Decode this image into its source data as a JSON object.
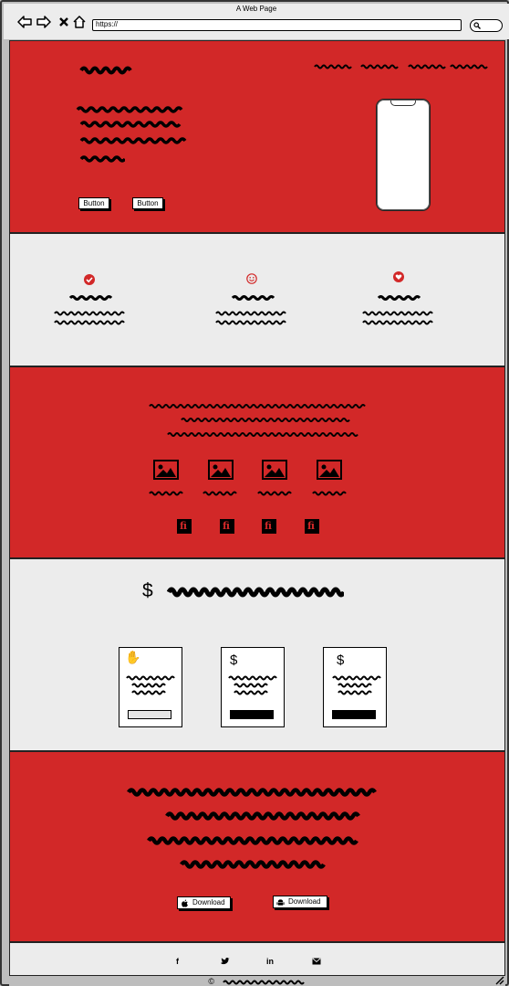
{
  "browser": {
    "title": "A Web Page",
    "url": "https://",
    "icons": [
      "back-icon",
      "forward-icon",
      "close-icon",
      "home-icon",
      "search-icon"
    ]
  },
  "hero": {
    "buttons": [
      "Button",
      "Button"
    ]
  },
  "features": {
    "icons": [
      "check-circle-icon",
      "smiley-icon",
      "heart-icon"
    ]
  },
  "gallery": {
    "image_count": 4,
    "social_glyph": "fi"
  },
  "pricing": {
    "currency_symbol": "$",
    "cards": [
      {
        "icon": "hand-pointer-icon",
        "glyph": "✋"
      },
      {
        "icon": "dollar-icon",
        "glyph": "$"
      },
      {
        "icon": "dollar-icon",
        "glyph": "$"
      }
    ]
  },
  "download": {
    "buttons": [
      {
        "label": "Download",
        "icon": "apple-icon"
      },
      {
        "label": "Download",
        "icon": "android-icon"
      }
    ]
  },
  "footer": {
    "social": [
      {
        "glyph": "f",
        "icon": "facebook-icon"
      },
      {
        "glyph": "❧",
        "icon": "twitter-icon"
      },
      {
        "glyph": "in",
        "icon": "linkedin-icon"
      },
      {
        "glyph": "✉",
        "icon": "mail-icon"
      }
    ],
    "copyright_symbol": "©"
  },
  "colors": {
    "accent": "#d22828",
    "panel": "#ececec"
  }
}
